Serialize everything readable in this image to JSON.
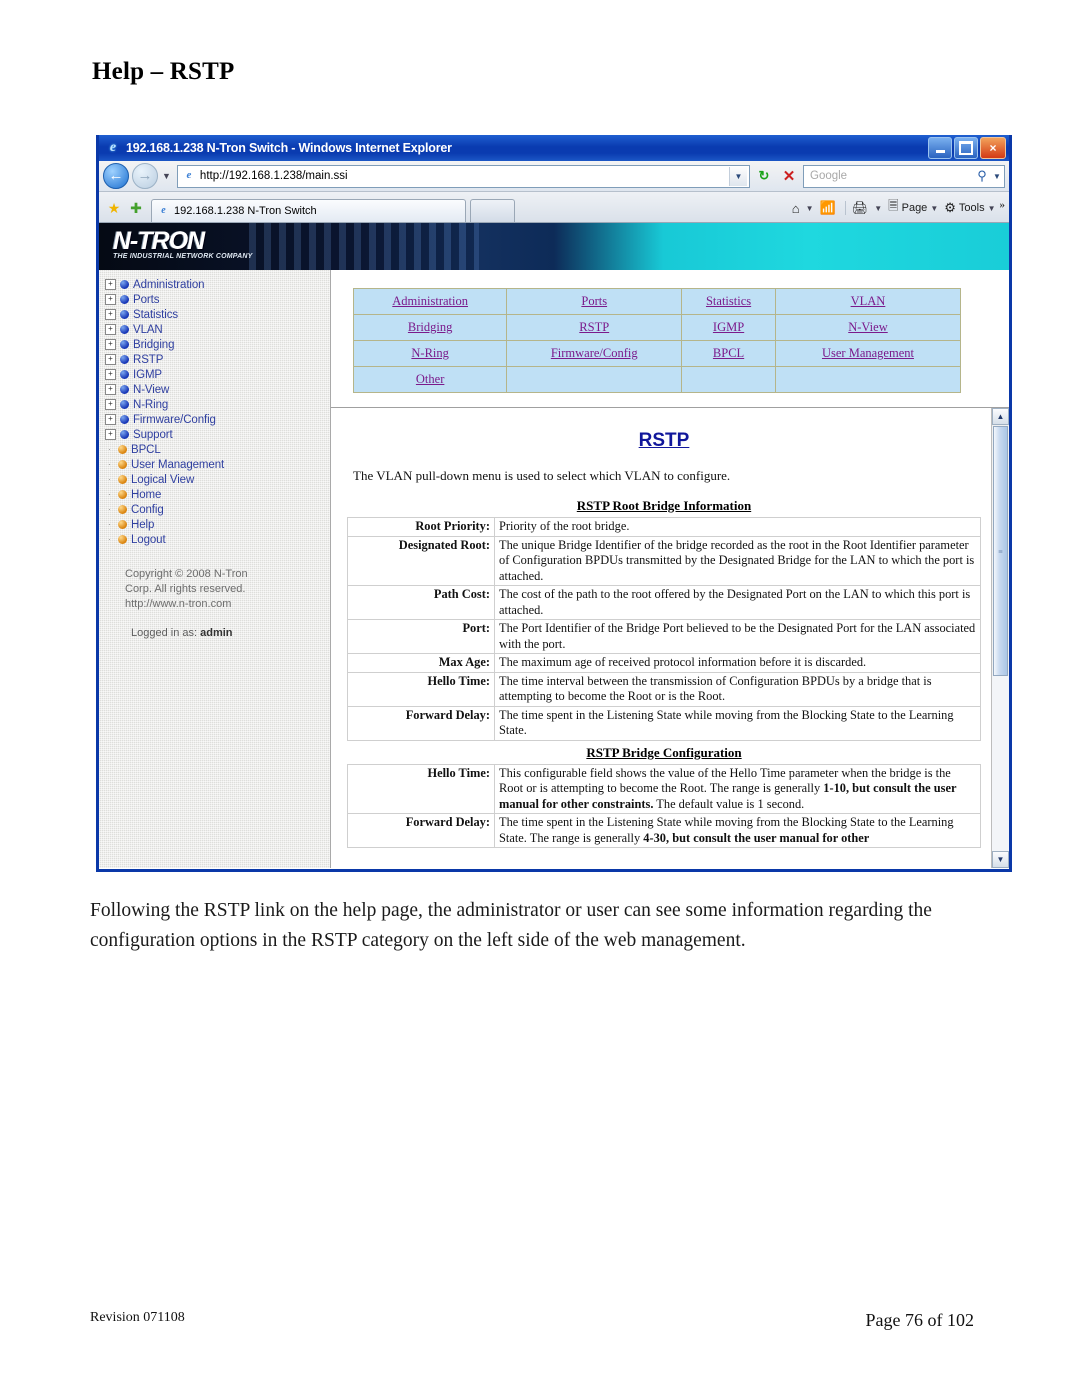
{
  "document": {
    "title": "Help – RSTP",
    "paragraph": "Following the RSTP link on the help page, the administrator or user can see some information regarding the configuration options in the RSTP category on the left side of the web management.",
    "footer_left": "Revision 071108",
    "footer_right": "Page 76 of 102"
  },
  "browser": {
    "window_title": "192.168.1.238 N-Tron Switch - Windows Internet Explorer",
    "ie_icon": "ie-logo-icon",
    "controls": {
      "minimize": "minimize-icon",
      "maximize": "maximize-icon",
      "close": "×"
    },
    "address": {
      "url": "http://192.168.1.238/main.ssi",
      "back_icon": "←",
      "forward_icon": "→",
      "dropdown_icon": "▼",
      "page_icon": "page-icon",
      "refresh_icon": "↻",
      "stop_icon": "✕",
      "search_placeholder": "Google",
      "search_icon": "search-icon",
      "search_dropdown_icon": "▼"
    },
    "tabs": {
      "favorites_star_icon": "★",
      "add_favorite_icon": "✚",
      "active_tab_label": "192.168.1.238 N-Tron Switch",
      "active_tab_icon": "page-icon"
    },
    "commandbar": [
      {
        "label": "",
        "icon": "home-icon",
        "has_dropdown": true
      },
      {
        "label": "",
        "icon": "rss-feed-icon",
        "has_dropdown": false
      },
      {
        "label": "",
        "icon": "print-icon",
        "has_dropdown": true
      },
      {
        "label": "Page",
        "icon": "page-icon",
        "has_dropdown": true
      },
      {
        "label": "Tools",
        "icon": "gear-icon",
        "has_dropdown": true
      }
    ],
    "overflow_icon": "»"
  },
  "webpage": {
    "brand": {
      "name": "N-TRON",
      "name_part1": "N-",
      "name_part2": "TRON",
      "tagline": "THE INDUSTRIAL NETWORK COMPANY"
    },
    "sidebar": {
      "tree": [
        {
          "label": "Administration",
          "bullet": "blue",
          "expandable": true
        },
        {
          "label": "Ports",
          "bullet": "blue",
          "expandable": true
        },
        {
          "label": "Statistics",
          "bullet": "blue",
          "expandable": true
        },
        {
          "label": "VLAN",
          "bullet": "blue",
          "expandable": true
        },
        {
          "label": "Bridging",
          "bullet": "blue",
          "expandable": true
        },
        {
          "label": "RSTP",
          "bullet": "blue",
          "expandable": true
        },
        {
          "label": "IGMP",
          "bullet": "blue",
          "expandable": true
        },
        {
          "label": "N-View",
          "bullet": "blue",
          "expandable": true
        },
        {
          "label": "N-Ring",
          "bullet": "blue",
          "expandable": true
        },
        {
          "label": "Firmware/Config",
          "bullet": "blue",
          "expandable": true
        },
        {
          "label": "Support",
          "bullet": "blue",
          "expandable": true
        },
        {
          "label": "BPCL",
          "bullet": "orange",
          "expandable": false
        },
        {
          "label": "User Management",
          "bullet": "orange",
          "expandable": false
        },
        {
          "label": "Logical View",
          "bullet": "orange",
          "expandable": false
        },
        {
          "label": "Home",
          "bullet": "orange",
          "expandable": false
        },
        {
          "label": "Config",
          "bullet": "orange",
          "expandable": false
        },
        {
          "label": "Help",
          "bullet": "orange",
          "expandable": false
        },
        {
          "label": "Logout",
          "bullet": "orange",
          "expandable": false
        }
      ],
      "copyright_line1": "Copyright © 2008 N-Tron",
      "copyright_line2": "Corp. All rights reserved.",
      "copyright_line3": "http://www.n-tron.com",
      "logged_in_prefix": "Logged in as:",
      "logged_in_user": "admin"
    },
    "link_table": {
      "rows": [
        [
          "Administration",
          "Ports",
          "Statistics",
          "VLAN"
        ],
        [
          "Bridging",
          "RSTP",
          "IGMP",
          "N-View"
        ],
        [
          "N-Ring",
          "Firmware/Config",
          "BPCL",
          "User Management"
        ],
        [
          "Other",
          "",
          "",
          ""
        ]
      ]
    },
    "help": {
      "heading": "RSTP",
      "lead": "The VLAN pull-down menu is used to select which VLAN to configure.",
      "sections": [
        {
          "title": "RSTP Root Bridge Information",
          "rows": [
            {
              "label": "Root Priority:",
              "text": "Priority of the root bridge."
            },
            {
              "label": "Designated Root:",
              "text": "The unique Bridge Identifier of the bridge recorded as the root in the Root Identifier parameter of Configuration BPDUs transmitted by the Designated Bridge for the LAN to which the port is attached."
            },
            {
              "label": "Path Cost:",
              "text": "The cost of the path to the root offered by the Designated Port on the LAN to which this port is attached."
            },
            {
              "label": "Port:",
              "text": "The Port Identifier of the Bridge Port believed to be the Designated Port for the LAN associated with the port."
            },
            {
              "label": "Max Age:",
              "text": "The maximum age of received protocol information before it is discarded."
            },
            {
              "label": "Hello Time:",
              "text": "The time interval between the transmission of Configuration BPDUs by a bridge that is attempting to become the Root or is the Root."
            },
            {
              "label": "Forward Delay:",
              "text": "The time spent in the Listening State while moving from the Blocking State to the Learning State."
            }
          ]
        },
        {
          "title": "RSTP Bridge Configuration",
          "rows": [
            {
              "label": "Hello Time:",
              "text_plain_1": "This configurable field shows the value of the Hello Time parameter when the bridge is the Root or is attempting to become the Root. The range is generally ",
              "text_bold_1": "1-10, but consult the user manual for other constraints.",
              "text_plain_2": " The default value is 1 second."
            },
            {
              "label": "Forward Delay:",
              "text_plain_1": "The time spent in the Listening State while moving from the Blocking State to the Learning State. The range is generally ",
              "text_bold_1": "4-30, but consult the user manual for other",
              "text_plain_2": ""
            }
          ]
        }
      ]
    },
    "scrollbar": {
      "up_icon": "▲",
      "down_icon": "▼",
      "grip_icon": "≡"
    }
  }
}
